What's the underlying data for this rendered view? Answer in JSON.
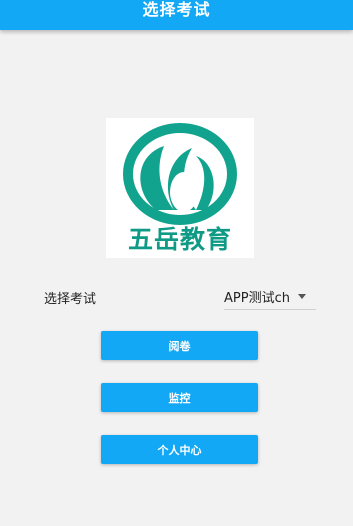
{
  "app_bar": {
    "title": "选择考试"
  },
  "logo": {
    "text": "五岳教育",
    "color": "#12A38F"
  },
  "exam_selector": {
    "label": "选择考试",
    "selected": "APP测试ch"
  },
  "buttons": {
    "review": "阅卷",
    "monitor": "监控",
    "personal_center": "个人中心"
  },
  "colors": {
    "accent": "#13A8F5",
    "background": "#F2F2F2"
  }
}
